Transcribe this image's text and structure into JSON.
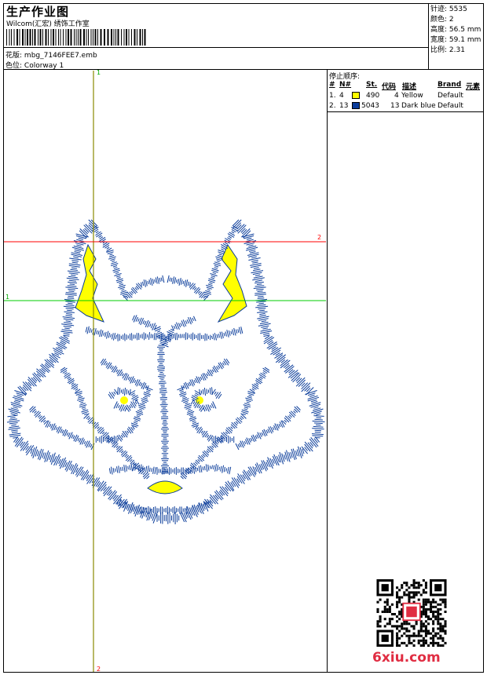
{
  "header": {
    "title": "生产作业图",
    "company": "Wilcom(汇宏) 绣饰工作室",
    "design_label": "花版:",
    "design_value": "mbg_7146FEE7.emb",
    "colorway_label": "色位:",
    "colorway_value": "Colorway 1"
  },
  "stats": [
    {
      "label": "针迹:",
      "value": "5535"
    },
    {
      "label": "颜色:",
      "value": "2"
    },
    {
      "label": "高度:",
      "value": "56.5 mm"
    },
    {
      "label": "宽度:",
      "value": "59.1 mm"
    },
    {
      "label": "比例:",
      "value": "2.31"
    }
  ],
  "stop_sequence": {
    "title": "停止顺序:",
    "columns": [
      "#",
      "N#",
      "St.",
      "代码",
      "描述",
      "Brand",
      "元素"
    ],
    "rows": [
      {
        "index": "1.",
        "needle": "4",
        "stitches": "490",
        "code": "4",
        "description": "Yellow",
        "brand": "Default",
        "color": "#ffff00"
      },
      {
        "index": "2.",
        "needle": "13",
        "stitches": "5043",
        "code": "13",
        "description": "Dark blue",
        "brand": "Default",
        "color": "#0a3c9a"
      }
    ]
  },
  "guides": {
    "vertical_top": "1",
    "vertical_bottom": "2",
    "horizontal_red": "2",
    "horizontal_green": "1",
    "red_color": "#ff0000",
    "green_color": "#00cc00",
    "olive_color": "#8a8a00"
  },
  "colors": {
    "blue": "#0a3c9a",
    "yellow": "#ffff00"
  },
  "watermark": "6xiu.com"
}
